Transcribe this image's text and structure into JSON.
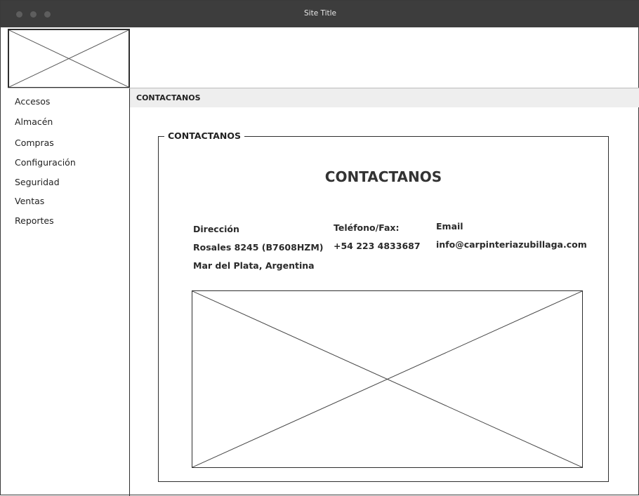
{
  "window": {
    "title": "Site Title"
  },
  "sidebar": {
    "items": [
      {
        "label": "Accesos"
      },
      {
        "label": "Almacén"
      },
      {
        "label": "Compras"
      },
      {
        "label": "Configuración"
      },
      {
        "label": "Seguridad"
      },
      {
        "label": "Ventas"
      },
      {
        "label": "Reportes"
      }
    ]
  },
  "breadcrumb": {
    "label": "CONTACTANOS"
  },
  "contact": {
    "legend": "CONTACTANOS",
    "heading": "CONTACTANOS",
    "address": {
      "label": "Dirección",
      "line1": "Rosales 8245 (B7608HZM)",
      "line2": "Mar del Plata, Argentina"
    },
    "phone": {
      "label": "Teléfono/Fax:",
      "value": "+54 223 4833687"
    },
    "email": {
      "label": "Email",
      "value": "info@carpinteriazubillaga.com"
    }
  },
  "icons": {
    "logo": "image-placeholder-icon",
    "map": "image-placeholder-icon"
  }
}
